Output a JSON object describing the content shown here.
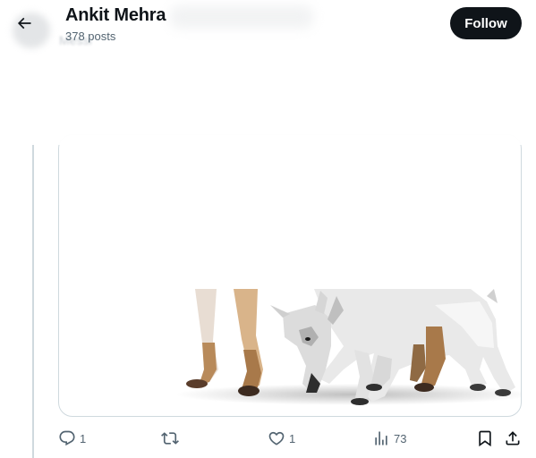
{
  "header": {
    "title": "Ankit Mehra",
    "posts_count": "378 posts",
    "follow_label": "Follow",
    "ghost_text": "Messi"
  },
  "post": {
    "actions": {
      "reply_count": "1",
      "repost_count": "",
      "like_count": "1",
      "views_count": "73"
    }
  },
  "icons": {
    "back": "arrow-left-icon",
    "reply": "reply-icon",
    "repost": "repost-icon",
    "like": "heart-icon",
    "views": "views-icon",
    "bookmark": "bookmark-icon",
    "share": "share-icon"
  },
  "colors": {
    "text": "#0f1419",
    "muted": "#536471",
    "border": "#cfd9de",
    "follow_bg": "#0f1419"
  }
}
